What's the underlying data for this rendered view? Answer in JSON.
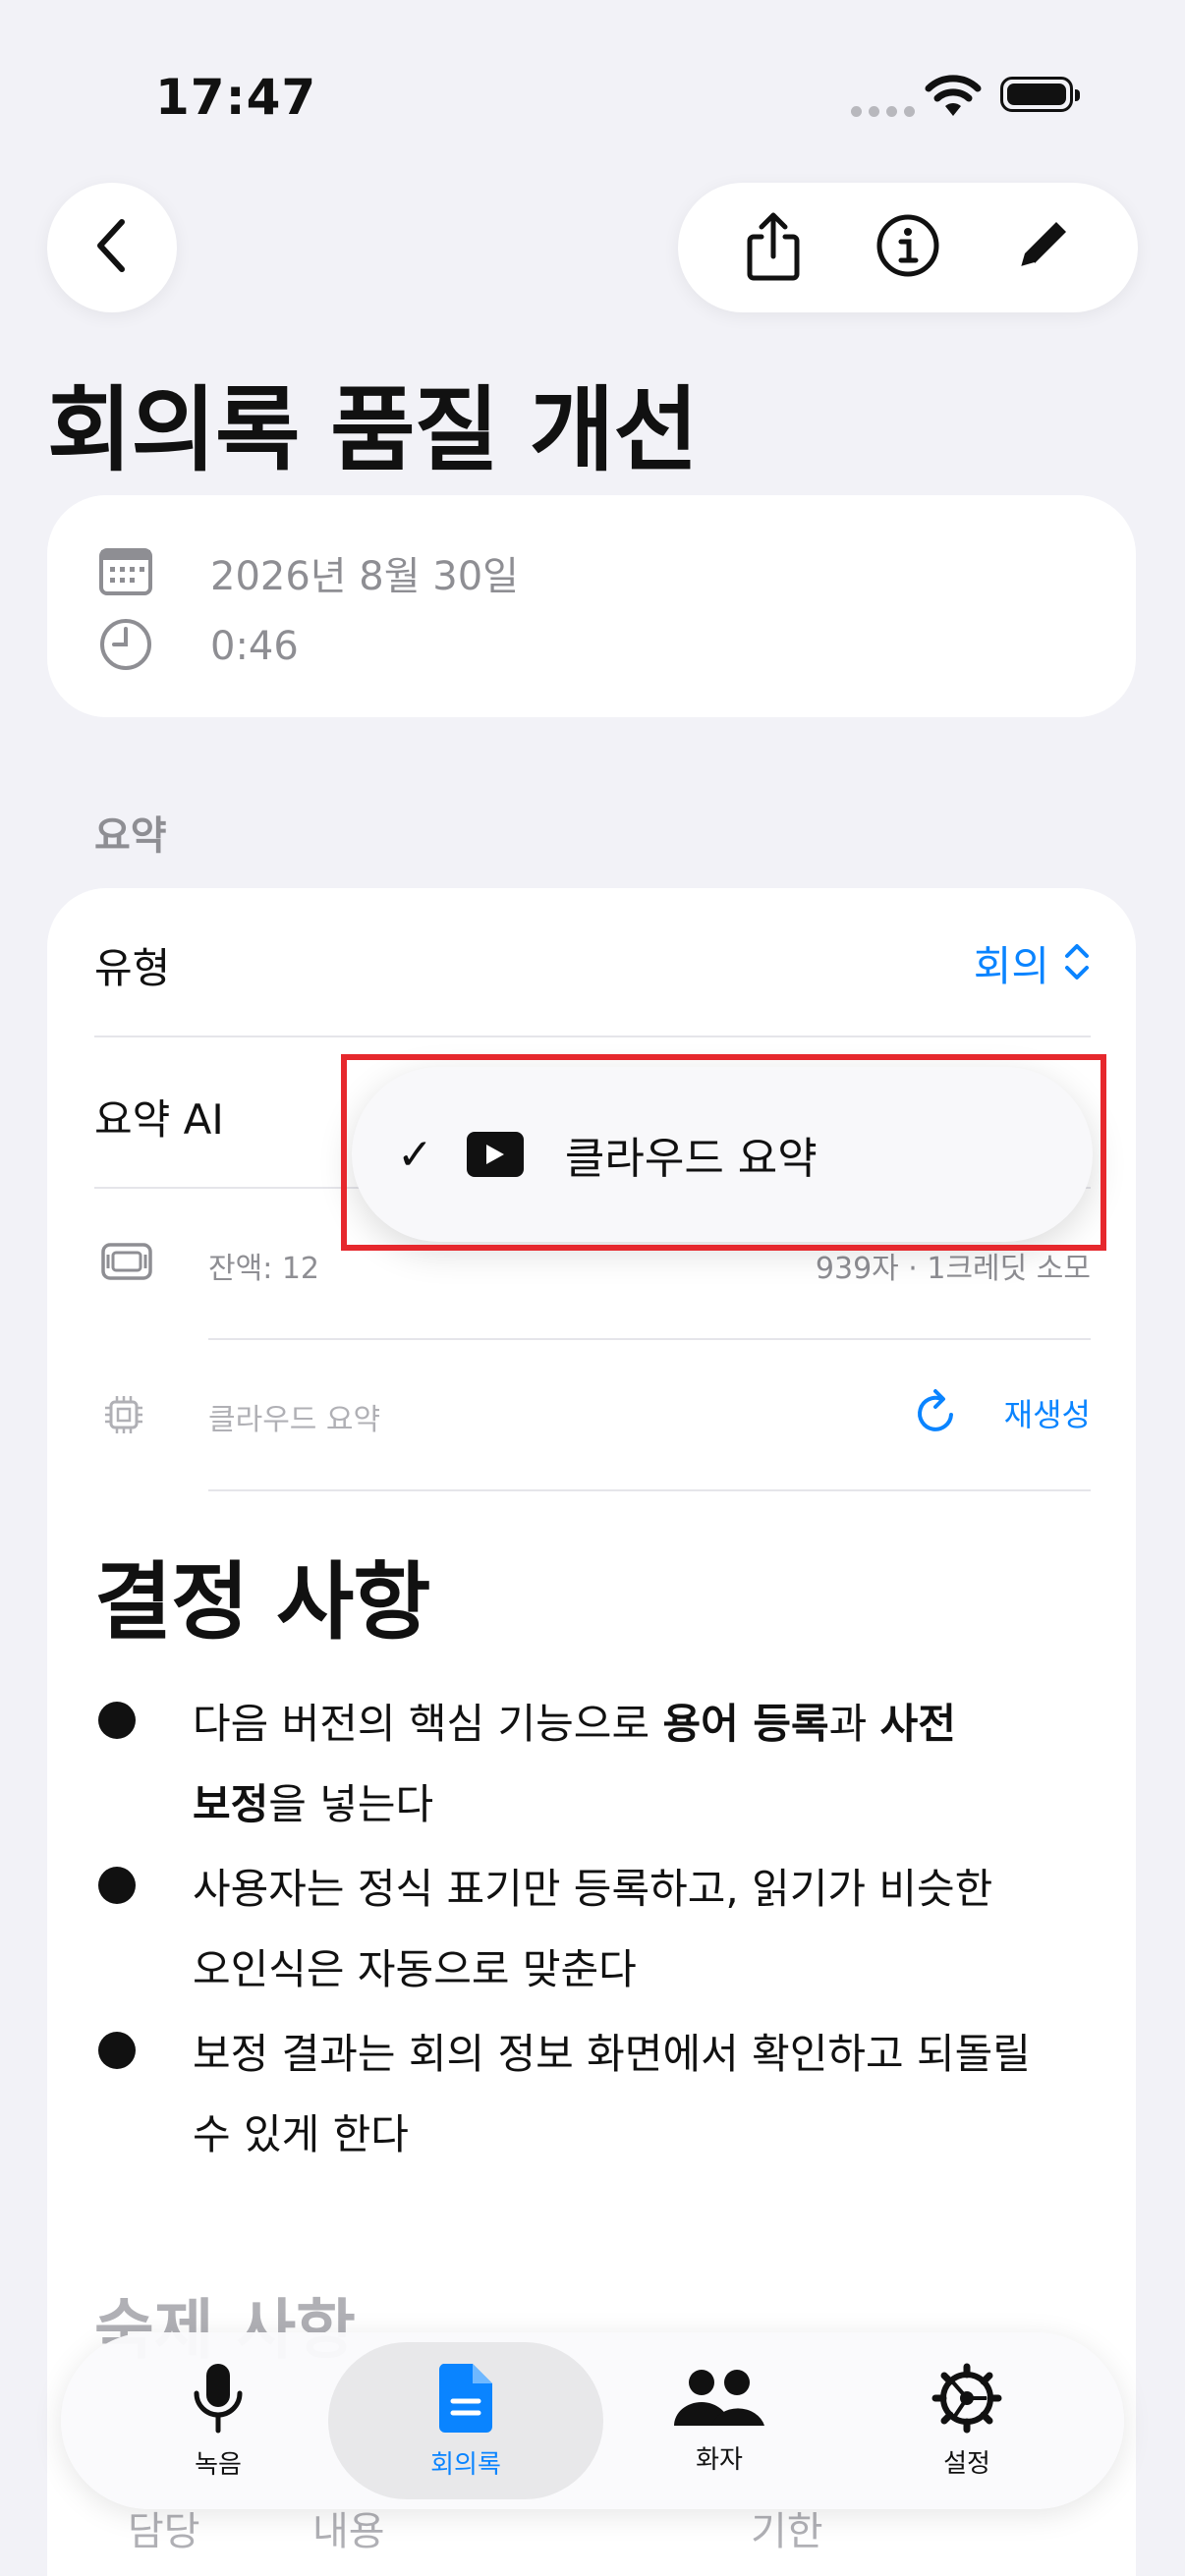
{
  "status_bar": {
    "time": "17:47"
  },
  "nav": {
    "back_icon": "chevron-left-icon",
    "actions": [
      "share-icon",
      "info-icon",
      "pencil-icon"
    ]
  },
  "page": {
    "title": "회의록 품질 개선"
  },
  "info": {
    "date": "2026년 8월 30일",
    "duration": "0:46"
  },
  "summary": {
    "section_label": "요약",
    "type_label": "유형",
    "type_value": "회의",
    "ai_label": "요약 AI",
    "balance": "잔액: 12",
    "usage": "939자 · 1크레딧 소모",
    "model": "클라우드 요약",
    "regenerate": "재생성"
  },
  "dropdown": {
    "selected_label": "클라우드 요약"
  },
  "decisions": {
    "heading": "결정 사항",
    "items": [
      {
        "a": "다음 버전의 핵심 기능으로 ",
        "b1": "용어 등록",
        "c": "과 ",
        "b2": "사전",
        "line2b": "보정",
        "line2": "을 넣는다"
      },
      {
        "line1": "사용자는 정식 표기만 등록하고, 읽기가 비슷한",
        "line2": "오인식은 자동으로 맞춘다"
      },
      {
        "line1": "보정 결과는 회의 정보 화면에서 확인하고 되돌릴",
        "line2": "수 있게 한다"
      }
    ]
  },
  "todo": {
    "heading": "숙제 사항",
    "col_owner": "담당",
    "col_content": "내용",
    "col_due": "기한"
  },
  "tabbar": {
    "tabs": [
      {
        "label": "녹음",
        "icon": "mic-icon"
      },
      {
        "label": "회의록",
        "icon": "document-icon"
      },
      {
        "label": "화자",
        "icon": "people-icon"
      },
      {
        "label": "설정",
        "icon": "gear-icon"
      }
    ],
    "active": "회의록"
  },
  "colors": {
    "accent": "#0a84ff",
    "highlight": "#e6282d"
  }
}
